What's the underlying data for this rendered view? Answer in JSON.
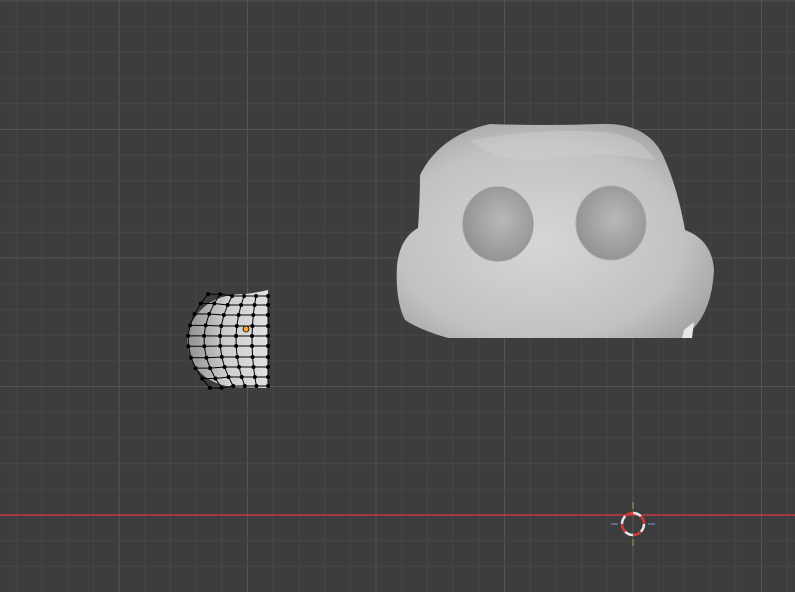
{
  "viewport": {
    "view": "front-orthographic",
    "background_color": "#3d3d3d",
    "grid": true,
    "grid_minor_color": "#474747",
    "grid_major_color": "#555555",
    "x_axis_color": "#c43a4a"
  },
  "objects": [
    {
      "name": "mask",
      "kind": "solid-mesh",
      "selected": false,
      "surface_color": "#bdbdbd",
      "holes": 2
    },
    {
      "name": "half-shell",
      "kind": "edit-mode-mesh",
      "selected": true,
      "surface_color": "#c8c8c8",
      "wire_color": "#000000",
      "origin_color": "#f2a52b"
    }
  ],
  "cursor_3d": {
    "name": "3d-cursor",
    "ring_colors": [
      "#e8e8e8",
      "#d33a3a"
    ],
    "gizmo_colors": [
      "#6ea0e0",
      "#7cc24a"
    ]
  }
}
